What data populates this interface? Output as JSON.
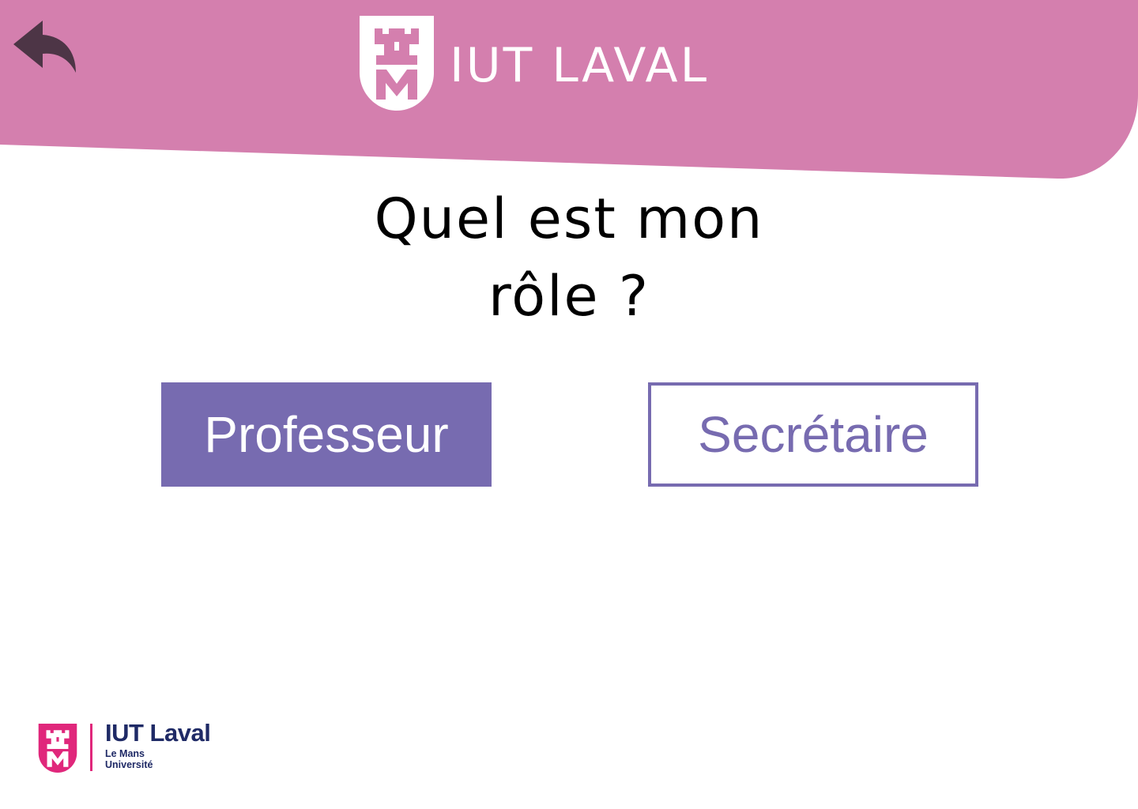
{
  "colors": {
    "header": "#d47fae",
    "accent": "#776bb0",
    "back_arrow": "#4d3546",
    "footer_brand": "#1f2a66",
    "footer_logo": "#e0277b"
  },
  "header": {
    "back_icon": "reply-arrow-icon",
    "logo_icon": "castle-shield-icon",
    "title": "IUT LAVAL"
  },
  "main": {
    "question_line1": "Quel est mon",
    "question_line2": "rôle ?",
    "buttons": [
      {
        "label": "Professeur",
        "selected": true
      },
      {
        "label": "Secrétaire",
        "selected": false
      }
    ]
  },
  "footer": {
    "logo_icon": "castle-shield-icon",
    "title": "IUT Laval",
    "subtitle_line1": "Le Mans",
    "subtitle_line2": "Université"
  }
}
